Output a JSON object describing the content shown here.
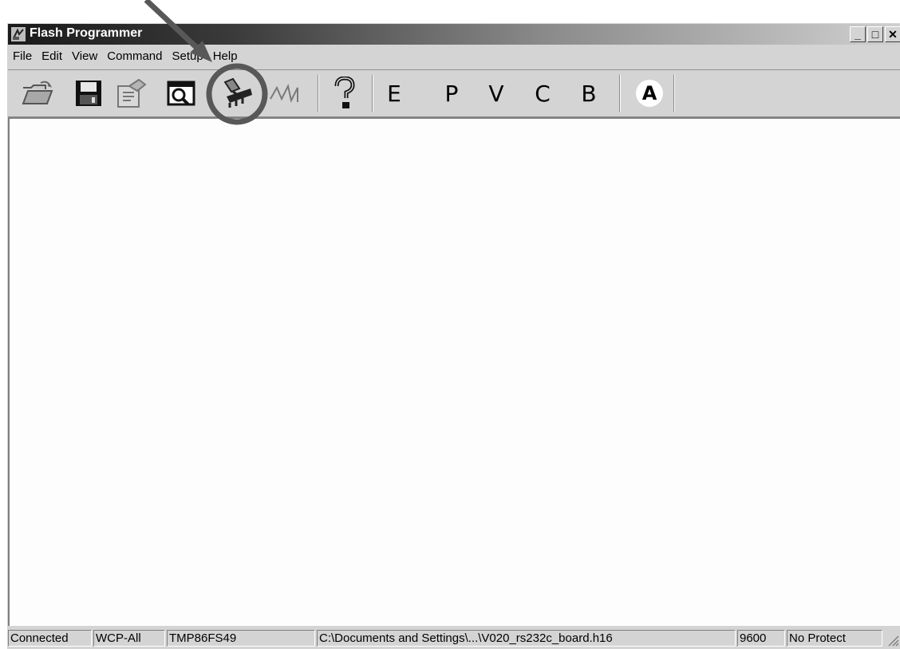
{
  "window": {
    "title": "Flash Programmer",
    "controls": {
      "minimize": "_",
      "maximize": "□",
      "close": "✕"
    }
  },
  "menu": [
    {
      "label": "File"
    },
    {
      "label": "Edit"
    },
    {
      "label": "View"
    },
    {
      "label": "Command"
    },
    {
      "label": "Setup"
    },
    {
      "label": "Help"
    }
  ],
  "toolbar": {
    "icons": [
      "open-folder-icon",
      "save-disk-icon",
      "properties-icon",
      "search-window-icon",
      "connect-programmer-icon",
      "waveform-icon",
      "help-question-icon"
    ],
    "letters": {
      "erase": "E",
      "program": "P",
      "verify": "V",
      "c": "C",
      "b": "B",
      "auto": "A"
    }
  },
  "status": {
    "connection": "Connected",
    "mode": "WCP-All",
    "device": "TMP86FS49",
    "file": "C:\\Documents and Settings\\...\\V020_rs232c_board.h16",
    "baud": "9600",
    "protect": "No Protect"
  },
  "annotation": {
    "color": "#585858"
  }
}
